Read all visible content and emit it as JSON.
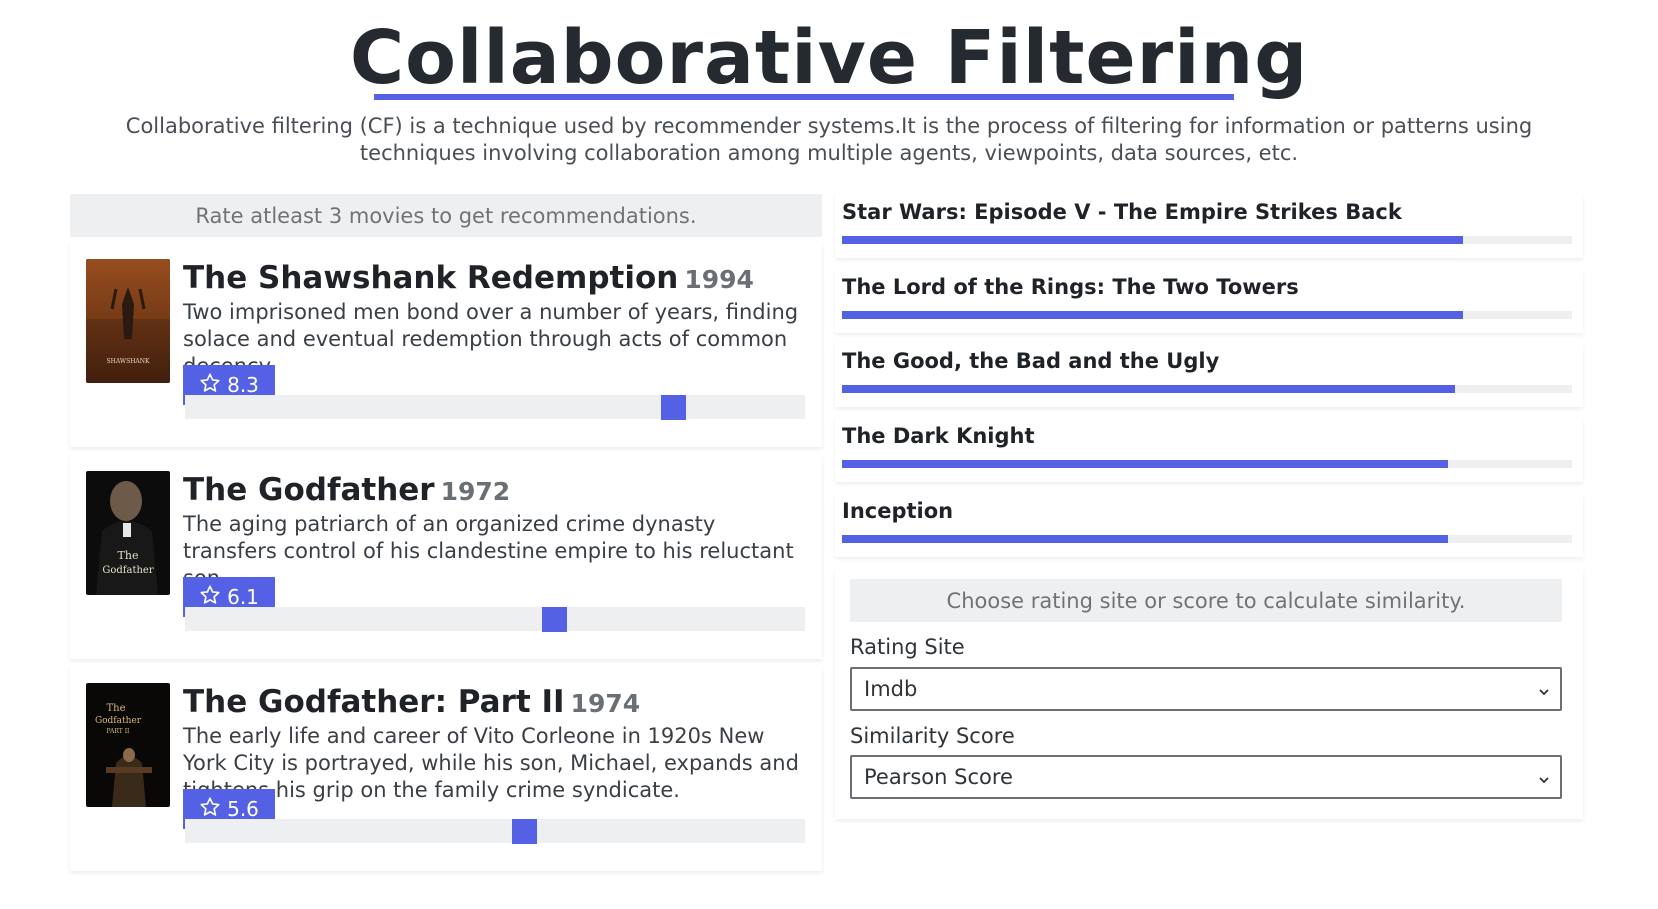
{
  "header": {
    "title": "Collaborative Filtering",
    "subtitle": "Collaborative filtering (CF) is a technique used by recommender systems.It is the process of filtering for information or patterns using techniques involving collaboration among multiple agents, viewpoints, data sources, etc."
  },
  "rate_hint": "Rate atleast 3 movies to get recommendations.",
  "movies": [
    {
      "title": "The Shawshank Redemption",
      "year": "1994",
      "description": "Two imprisoned men bond over a number of years, finding solace and eventual redemption through acts of common decency.",
      "rating": "8.3",
      "slider_fraction": 0.8
    },
    {
      "title": "The Godfather",
      "year": "1972",
      "description": "The aging patriarch of an organized crime dynasty transfers control of his clandestine empire to his reluctant son.",
      "rating": "6.1",
      "slider_fraction": 0.6
    },
    {
      "title": "The Godfather: Part II",
      "year": "1974",
      "description": "The early life and career of Vito Corleone in 1920s New York City is portrayed, while his son, Michael, expands and tightens his grip on the family crime syndicate.",
      "rating": "5.6",
      "slider_fraction": 0.55
    }
  ],
  "recommendations": [
    {
      "title": "Star Wars: Episode V - The Empire Strikes Back",
      "score_fraction": 0.85
    },
    {
      "title": "The Lord of the Rings: The Two Towers",
      "score_fraction": 0.85
    },
    {
      "title": "The Good, the Bad and the Ugly",
      "score_fraction": 0.84
    },
    {
      "title": "The Dark Knight",
      "score_fraction": 0.83
    },
    {
      "title": "Inception",
      "score_fraction": 0.83
    }
  ],
  "settings": {
    "hint": "Choose rating site or score to calculate similarity.",
    "rating_site_label": "Rating Site",
    "rating_site_value": "Imdb",
    "similarity_label": "Similarity Score",
    "similarity_value": "Pearson Score"
  },
  "colors": {
    "accent": "#5461e4",
    "panel_gray": "#eeeff0"
  },
  "icons": {
    "rating": "star-outline-icon",
    "select": "chevron-down-icon"
  }
}
